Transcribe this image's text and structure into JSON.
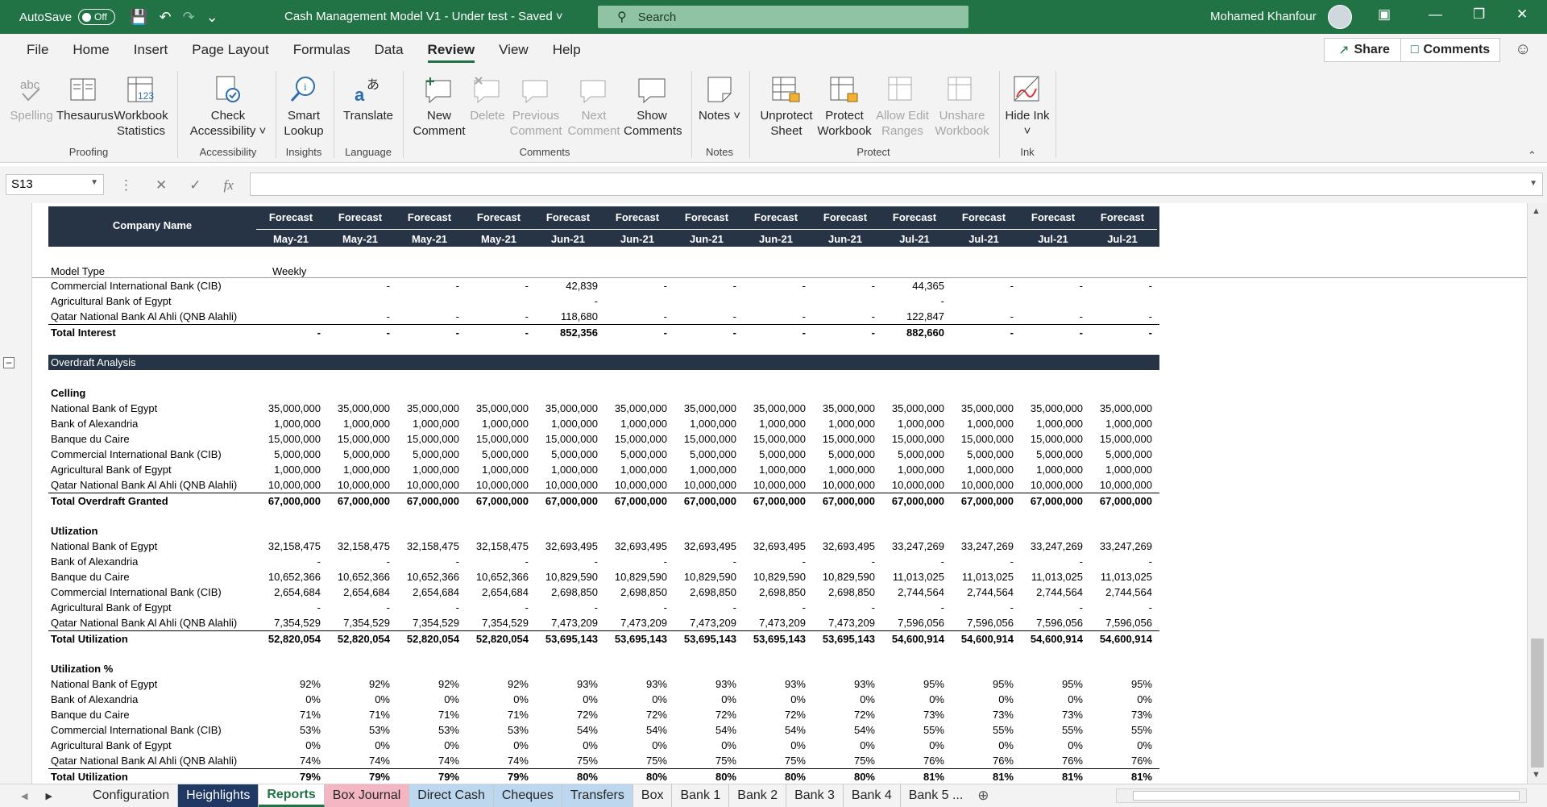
{
  "titlebar": {
    "autosave_label": "AutoSave",
    "autosave_state": "Off",
    "doc_title": "Cash Management Model V1 - Under test  -  Saved  ˅",
    "search_placeholder": "Search",
    "user_name": "Mohamed Khanfour"
  },
  "menu": {
    "tabs": [
      "File",
      "Home",
      "Insert",
      "Page Layout",
      "Formulas",
      "Data",
      "Review",
      "View",
      "Help"
    ],
    "active": "Review",
    "share": "Share",
    "comments": "Comments"
  },
  "ribbon": {
    "buttons": [
      {
        "label": "Spelling",
        "disabled": true
      },
      {
        "label": "Thesaurus",
        "disabled": false
      },
      {
        "label": "Workbook Statistics",
        "disabled": false
      },
      {
        "label": "Check Accessibility ˅",
        "disabled": false
      },
      {
        "label": "Smart Lookup",
        "disabled": false
      },
      {
        "label": "Translate",
        "disabled": false
      },
      {
        "label": "New Comment",
        "disabled": false
      },
      {
        "label": "Delete",
        "disabled": true
      },
      {
        "label": "Previous Comment",
        "disabled": true
      },
      {
        "label": "Next Comment",
        "disabled": true
      },
      {
        "label": "Show Comments",
        "disabled": false
      },
      {
        "label": "Notes ˅",
        "disabled": false
      },
      {
        "label": "Unprotect Sheet",
        "disabled": false
      },
      {
        "label": "Protect Workbook",
        "disabled": false
      },
      {
        "label": "Allow Edit Ranges",
        "disabled": true
      },
      {
        "label": "Unshare Workbook",
        "disabled": true
      },
      {
        "label": "Hide Ink ˅",
        "disabled": false
      }
    ],
    "groups": [
      "Proofing",
      "Accessibility",
      "Insights",
      "Language",
      "Comments",
      "Notes",
      "Protect",
      "Ink"
    ]
  },
  "formula_bar": {
    "name_box": "S13",
    "formula": ""
  },
  "sheet": {
    "company_header": "Company Name",
    "forecast_label": "Forecast",
    "months": [
      "May-21",
      "May-21",
      "May-21",
      "May-21",
      "Jun-21",
      "Jun-21",
      "Jun-21",
      "Jun-21",
      "Jun-21",
      "Jul-21",
      "Jul-21",
      "Jul-21",
      "Jul-21"
    ],
    "model_type_label": "Model Type",
    "model_type_value": "Weekly",
    "interest_rows": [
      {
        "label": "Commercial International Bank (CIB)",
        "values": [
          "",
          "-",
          "-",
          "-",
          "42,839",
          "-",
          "-",
          "-",
          "-",
          "44,365",
          "-",
          "-",
          "-"
        ]
      },
      {
        "label": "Agricultural Bank of Egypt",
        "values": [
          "",
          "",
          "",
          "",
          "-",
          "",
          "",
          "",
          "",
          "-",
          "",
          "",
          ""
        ]
      },
      {
        "label": "Qatar National Bank Al Ahli (QNB Alahli)",
        "values": [
          "",
          "-",
          "-",
          "-",
          "118,680",
          "-",
          "-",
          "-",
          "-",
          "122,847",
          "-",
          "-",
          "-"
        ]
      },
      {
        "label": "Total Interest",
        "values": [
          "-",
          "-",
          "-",
          "-",
          "852,356",
          "-",
          "-",
          "-",
          "-",
          "882,660",
          "-",
          "-",
          "-"
        ],
        "bold": true,
        "total": true
      }
    ],
    "overdraft_title": "Overdraft Analysis",
    "ceiling_title": "Celling",
    "ceiling_rows": [
      {
        "label": "National Bank of Egypt",
        "values": [
          "35,000,000",
          "35,000,000",
          "35,000,000",
          "35,000,000",
          "35,000,000",
          "35,000,000",
          "35,000,000",
          "35,000,000",
          "35,000,000",
          "35,000,000",
          "35,000,000",
          "35,000,000",
          "35,000,000"
        ]
      },
      {
        "label": "Bank of Alexandria",
        "values": [
          "1,000,000",
          "1,000,000",
          "1,000,000",
          "1,000,000",
          "1,000,000",
          "1,000,000",
          "1,000,000",
          "1,000,000",
          "1,000,000",
          "1,000,000",
          "1,000,000",
          "1,000,000",
          "1,000,000"
        ]
      },
      {
        "label": "Banque du Caire",
        "values": [
          "15,000,000",
          "15,000,000",
          "15,000,000",
          "15,000,000",
          "15,000,000",
          "15,000,000",
          "15,000,000",
          "15,000,000",
          "15,000,000",
          "15,000,000",
          "15,000,000",
          "15,000,000",
          "15,000,000"
        ]
      },
      {
        "label": "Commercial International Bank (CIB)",
        "values": [
          "5,000,000",
          "5,000,000",
          "5,000,000",
          "5,000,000",
          "5,000,000",
          "5,000,000",
          "5,000,000",
          "5,000,000",
          "5,000,000",
          "5,000,000",
          "5,000,000",
          "5,000,000",
          "5,000,000"
        ]
      },
      {
        "label": "Agricultural Bank of Egypt",
        "values": [
          "1,000,000",
          "1,000,000",
          "1,000,000",
          "1,000,000",
          "1,000,000",
          "1,000,000",
          "1,000,000",
          "1,000,000",
          "1,000,000",
          "1,000,000",
          "1,000,000",
          "1,000,000",
          "1,000,000"
        ]
      },
      {
        "label": "Qatar National Bank Al Ahli (QNB Alahli)",
        "values": [
          "10,000,000",
          "10,000,000",
          "10,000,000",
          "10,000,000",
          "10,000,000",
          "10,000,000",
          "10,000,000",
          "10,000,000",
          "10,000,000",
          "10,000,000",
          "10,000,000",
          "10,000,000",
          "10,000,000"
        ]
      },
      {
        "label": "Total Overdraft Granted",
        "values": [
          "67,000,000",
          "67,000,000",
          "67,000,000",
          "67,000,000",
          "67,000,000",
          "67,000,000",
          "67,000,000",
          "67,000,000",
          "67,000,000",
          "67,000,000",
          "67,000,000",
          "67,000,000",
          "67,000,000"
        ],
        "bold": true,
        "total": true
      }
    ],
    "utilization_title": "Utlization",
    "utilization_rows": [
      {
        "label": "National Bank of Egypt",
        "values": [
          "32,158,475",
          "32,158,475",
          "32,158,475",
          "32,158,475",
          "32,693,495",
          "32,693,495",
          "32,693,495",
          "32,693,495",
          "32,693,495",
          "33,247,269",
          "33,247,269",
          "33,247,269",
          "33,247,269"
        ]
      },
      {
        "label": "Bank of Alexandria",
        "values": [
          "-",
          "-",
          "-",
          "-",
          "-",
          "-",
          "-",
          "-",
          "-",
          "-",
          "-",
          "-",
          "-"
        ]
      },
      {
        "label": "Banque du Caire",
        "values": [
          "10,652,366",
          "10,652,366",
          "10,652,366",
          "10,652,366",
          "10,829,590",
          "10,829,590",
          "10,829,590",
          "10,829,590",
          "10,829,590",
          "11,013,025",
          "11,013,025",
          "11,013,025",
          "11,013,025"
        ]
      },
      {
        "label": "Commercial International Bank (CIB)",
        "values": [
          "2,654,684",
          "2,654,684",
          "2,654,684",
          "2,654,684",
          "2,698,850",
          "2,698,850",
          "2,698,850",
          "2,698,850",
          "2,698,850",
          "2,744,564",
          "2,744,564",
          "2,744,564",
          "2,744,564"
        ]
      },
      {
        "label": "Agricultural Bank of Egypt",
        "values": [
          "-",
          "-",
          "-",
          "-",
          "-",
          "-",
          "-",
          "-",
          "-",
          "-",
          "-",
          "-",
          "-"
        ]
      },
      {
        "label": "Qatar National Bank Al Ahli (QNB Alahli)",
        "values": [
          "7,354,529",
          "7,354,529",
          "7,354,529",
          "7,354,529",
          "7,473,209",
          "7,473,209",
          "7,473,209",
          "7,473,209",
          "7,473,209",
          "7,596,056",
          "7,596,056",
          "7,596,056",
          "7,596,056"
        ]
      },
      {
        "label": "Total Utilization",
        "values": [
          "52,820,054",
          "52,820,054",
          "52,820,054",
          "52,820,054",
          "53,695,143",
          "53,695,143",
          "53,695,143",
          "53,695,143",
          "53,695,143",
          "54,600,914",
          "54,600,914",
          "54,600,914",
          "54,600,914"
        ],
        "bold": true,
        "total": true
      }
    ],
    "utilization_pct_title": "Utilization %",
    "utilization_pct_rows": [
      {
        "label": "National Bank of Egypt",
        "values": [
          "92%",
          "92%",
          "92%",
          "92%",
          "93%",
          "93%",
          "93%",
          "93%",
          "93%",
          "95%",
          "95%",
          "95%",
          "95%"
        ]
      },
      {
        "label": "Bank of Alexandria",
        "values": [
          "0%",
          "0%",
          "0%",
          "0%",
          "0%",
          "0%",
          "0%",
          "0%",
          "0%",
          "0%",
          "0%",
          "0%",
          "0%"
        ]
      },
      {
        "label": "Banque du Caire",
        "values": [
          "71%",
          "71%",
          "71%",
          "71%",
          "72%",
          "72%",
          "72%",
          "72%",
          "72%",
          "73%",
          "73%",
          "73%",
          "73%"
        ]
      },
      {
        "label": "Commercial International Bank (CIB)",
        "values": [
          "53%",
          "53%",
          "53%",
          "53%",
          "54%",
          "54%",
          "54%",
          "54%",
          "54%",
          "55%",
          "55%",
          "55%",
          "55%"
        ]
      },
      {
        "label": "Agricultural Bank of Egypt",
        "values": [
          "0%",
          "0%",
          "0%",
          "0%",
          "0%",
          "0%",
          "0%",
          "0%",
          "0%",
          "0%",
          "0%",
          "0%",
          "0%"
        ]
      },
      {
        "label": "Qatar National Bank Al Ahli (QNB Alahli)",
        "values": [
          "74%",
          "74%",
          "74%",
          "74%",
          "75%",
          "75%",
          "75%",
          "75%",
          "75%",
          "76%",
          "76%",
          "76%",
          "76%"
        ]
      },
      {
        "label": "Total Utilization",
        "values": [
          "79%",
          "79%",
          "79%",
          "79%",
          "80%",
          "80%",
          "80%",
          "80%",
          "80%",
          "81%",
          "81%",
          "81%",
          "81%"
        ],
        "bold": true,
        "total": true
      }
    ]
  },
  "sheet_tabs": [
    {
      "label": "Configuration",
      "color": ""
    },
    {
      "label": "Heighlights",
      "color": "#1f3864"
    },
    {
      "label": "Reports",
      "color": "",
      "active": true
    },
    {
      "label": "Box Journal",
      "color": "#f4b6c2"
    },
    {
      "label": "Direct Cash",
      "color": "#bdd7ee"
    },
    {
      "label": "Cheques",
      "color": "#bdd7ee"
    },
    {
      "label": "Transfers",
      "color": "#bdd7ee"
    },
    {
      "label": "Box",
      "color": ""
    },
    {
      "label": "Bank 1",
      "color": ""
    },
    {
      "label": "Bank 2",
      "color": ""
    },
    {
      "label": "Bank 3",
      "color": ""
    },
    {
      "label": "Bank 4",
      "color": ""
    },
    {
      "label": "Bank 5 ...",
      "color": ""
    }
  ],
  "colors": {
    "excel_green": "#217346",
    "header_navy": "#263446"
  }
}
